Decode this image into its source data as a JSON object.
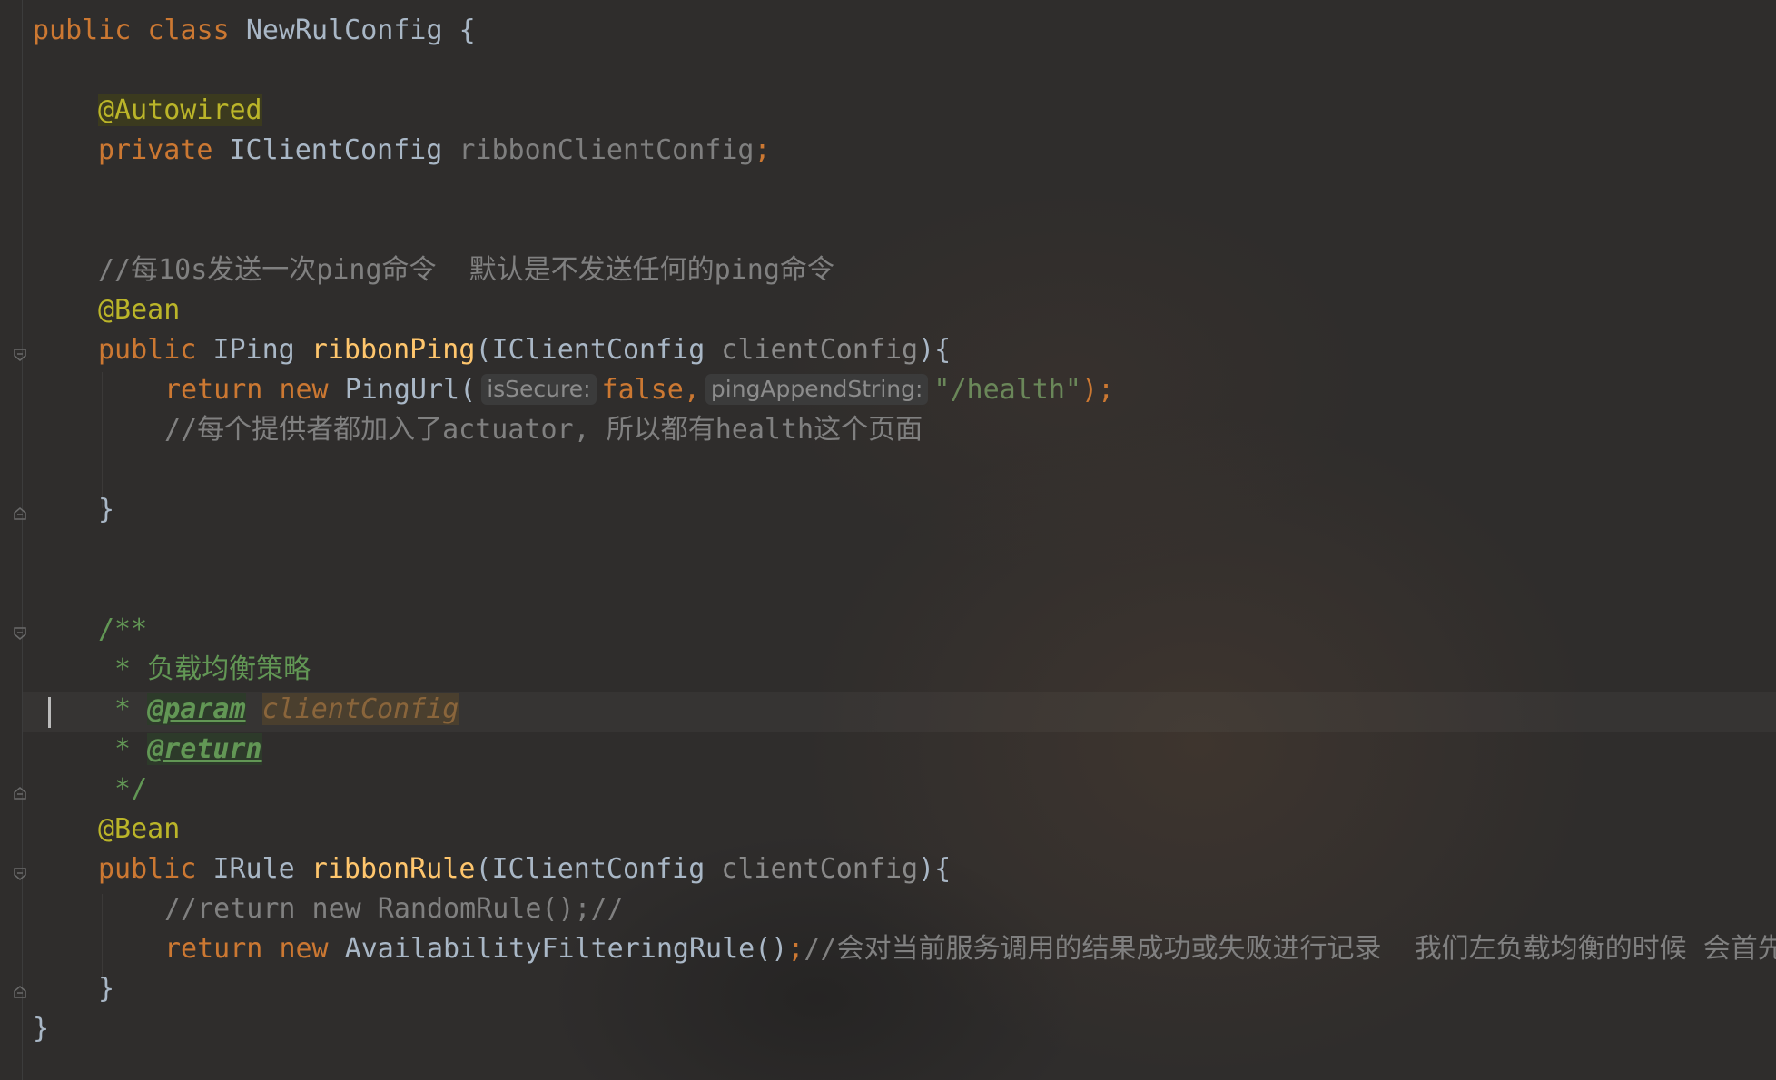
{
  "editor": {
    "lines": {
      "class_decl": {
        "kw1": "public",
        "kw2": "class",
        "name": "NewRulConfig",
        "brace": " {"
      },
      "autowired": {
        "annotation": "@Autowired"
      },
      "field": {
        "kw": "private",
        "type": "IClientConfig",
        "name": "ribbonClientConfig",
        "semi": ";"
      },
      "comment1": {
        "text": "//每10s发送一次ping命令  默认是不发送任何的ping命令"
      },
      "bean1": {
        "annotation": "@Bean"
      },
      "method1": {
        "kw": "public",
        "type": "IPing",
        "name": "ribbonPing",
        "open": "(",
        "param_type": "IClientConfig",
        "param_name": "clientConfig",
        "close": "){"
      },
      "return1": {
        "kw1": "return",
        "kw2": "new",
        "ctor": "PingUrl(",
        "hint1": "isSecure:",
        "arg1": "false,",
        "hint2": "pingAppendString:",
        "arg2": "\"/health\"",
        "end": ");"
      },
      "comment2": {
        "text": "//每个提供者都加入了actuator, 所以都有health这个页面"
      },
      "close1": {
        "text": "}"
      },
      "doc_open": {
        "text": "/**"
      },
      "doc_desc": {
        "text": " * 负载均衡策略"
      },
      "doc_param": {
        "prefix": " * ",
        "tag": "@param",
        "name": "clientConfig"
      },
      "doc_return": {
        "prefix": " * ",
        "tag": "@return"
      },
      "doc_close": {
        "text": " */"
      },
      "bean2": {
        "annotation": "@Bean"
      },
      "method2": {
        "kw": "public",
        "type": "IRule",
        "name": "ribbonRule",
        "open": "(",
        "param_type": "IClientConfig",
        "param_name": "clientConfig",
        "close": "){"
      },
      "comment3": {
        "text": "//return new RandomRule();//"
      },
      "return2": {
        "kw1": "return",
        "kw2": "new",
        "ctor": "AvailabilityFilteringRule()",
        "semi": ";",
        "comment": "//会对当前服务调用的结果成功或失败进行记录  我们左负载均衡的时候 会首先"
      },
      "close2": {
        "text": "}"
      },
      "close_class": {
        "text": "}"
      }
    }
  },
  "colors": {
    "background": "#2b2b2b",
    "keyword": "#cc7832",
    "annotation": "#bbb529",
    "method": "#ffc66d",
    "string": "#6a8759",
    "comment": "#808080",
    "javadoc": "#629755",
    "text": "#a9b7c6"
  }
}
